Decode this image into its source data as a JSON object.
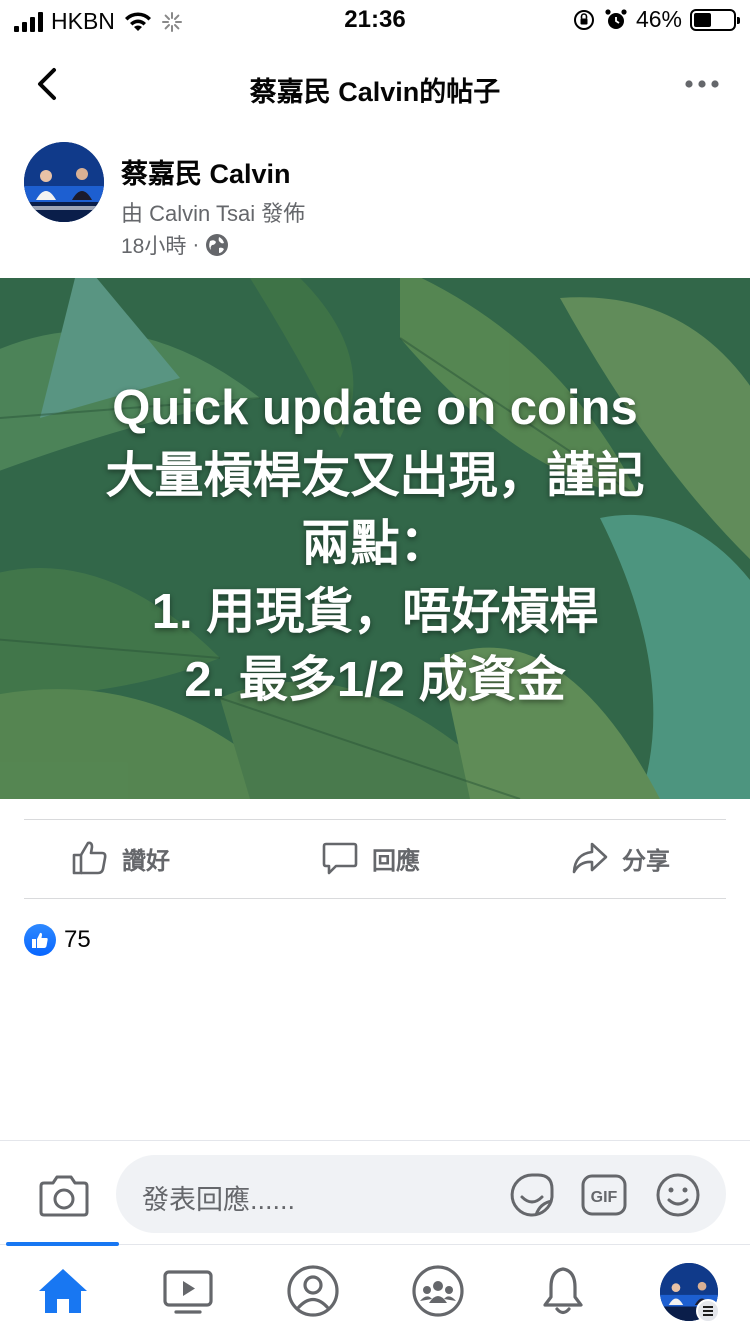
{
  "status_bar": {
    "carrier": "HKBN",
    "time": "21:36",
    "battery": "46%",
    "battery_level": 0.46,
    "icons": [
      "signal-icon",
      "wifi-icon",
      "loading-icon",
      "rotation-lock-icon",
      "alarm-icon",
      "battery-icon"
    ]
  },
  "nav": {
    "title": "蔡嘉民 Calvin的帖子",
    "icons": [
      "back-chevron-icon",
      "more-dots-icon"
    ]
  },
  "post": {
    "author": "蔡嘉民 Calvin",
    "posted_by": "由 Calvin Tsai 發佈",
    "time": "18小時",
    "separator": "·",
    "privacy_icon": "globe-icon",
    "image_text": [
      "Quick update on coins",
      "大量槓桿友又出現，謹記",
      "兩點：",
      "1. 用現貨，唔好槓桿",
      "2. 最多1/2 成資金"
    ]
  },
  "actions": {
    "like": "讚好",
    "comment": "回應",
    "share": "分享"
  },
  "reactions": {
    "count": "75",
    "icon": "like-reaction-icon"
  },
  "comment_bar": {
    "placeholder": "發表回應......",
    "icons": [
      "camera-icon",
      "sticker-icon",
      "gif-icon",
      "emoji-icon"
    ]
  },
  "tabbar": {
    "tabs": [
      "home-icon",
      "watch-icon",
      "profile-icon",
      "groups-icon",
      "notifications-icon",
      "menu-avatar"
    ]
  },
  "colors": {
    "accent": "#1877f2",
    "secondary_text": "#65676b",
    "image_green": "#3f7a55"
  }
}
